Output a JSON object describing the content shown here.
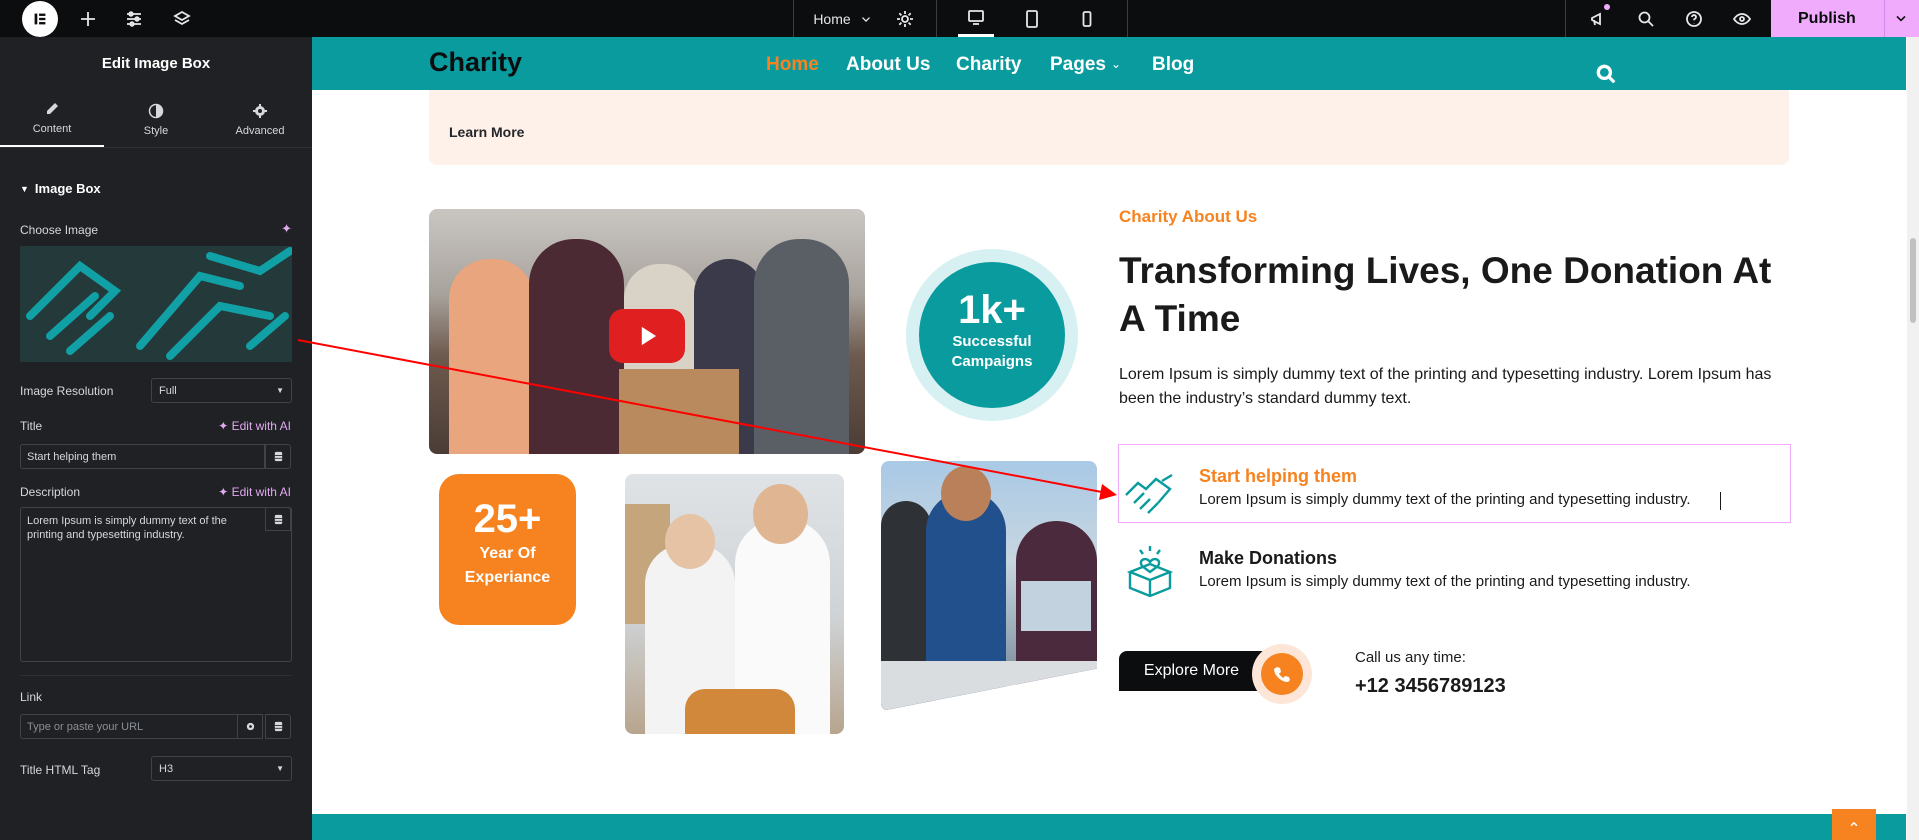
{
  "topbar": {
    "page_select": "Home",
    "publish_label": "Publish"
  },
  "sidebar": {
    "title": "Edit Image Box",
    "tabs": [
      {
        "label": "Content",
        "icon": "pencil-icon"
      },
      {
        "label": "Style",
        "icon": "half-circle-icon"
      },
      {
        "label": "Advanced",
        "icon": "gear-icon"
      }
    ],
    "section_title": "Image Box",
    "choose_image_label": "Choose Image",
    "image_resolution_label": "Image Resolution",
    "image_resolution_value": "Full",
    "title_label": "Title",
    "title_value": "Start helping them",
    "edit_ai_label": "Edit with AI",
    "description_label": "Description",
    "description_value": "Lorem Ipsum is simply dummy text of the printing and typesetting industry.",
    "link_label": "Link",
    "link_placeholder": "Type or paste your URL",
    "title_html_tag_label": "Title HTML Tag",
    "title_html_tag_value": "H3"
  },
  "site": {
    "logo": "Charity",
    "nav": [
      "Home",
      "About Us",
      "Charity",
      "Pages",
      "Blog"
    ],
    "learn_more": "Learn More",
    "stat1": {
      "value": "1k+",
      "line1": "Successful",
      "line2": "Campaigns"
    },
    "stat2": {
      "value": "25+",
      "line1": "Year Of",
      "line2": "Experiance"
    },
    "subtitle": "Charity About Us",
    "heading": "Transforming Lives, One Donation At A Time",
    "paragraph": "Lorem Ipsum is simply dummy text of the printing and typesetting industry. Lorem Ipsum has been the industry’s standard dummy text.",
    "box1": {
      "title": "Start helping them",
      "desc": "Lorem Ipsum is simply dummy text of the printing and typesetting industry."
    },
    "box2": {
      "title": "Make Donations",
      "desc": "Lorem Ipsum is simply dummy text of the printing and typesetting industry."
    },
    "explore": "Explore More",
    "call_label": "Call us any time:",
    "phone": "+12 3456789123"
  },
  "colors": {
    "teal": "#0a9b9f",
    "orange": "#f6831f",
    "accent_pink": "#f0abfc",
    "panel": "#1f2124"
  }
}
